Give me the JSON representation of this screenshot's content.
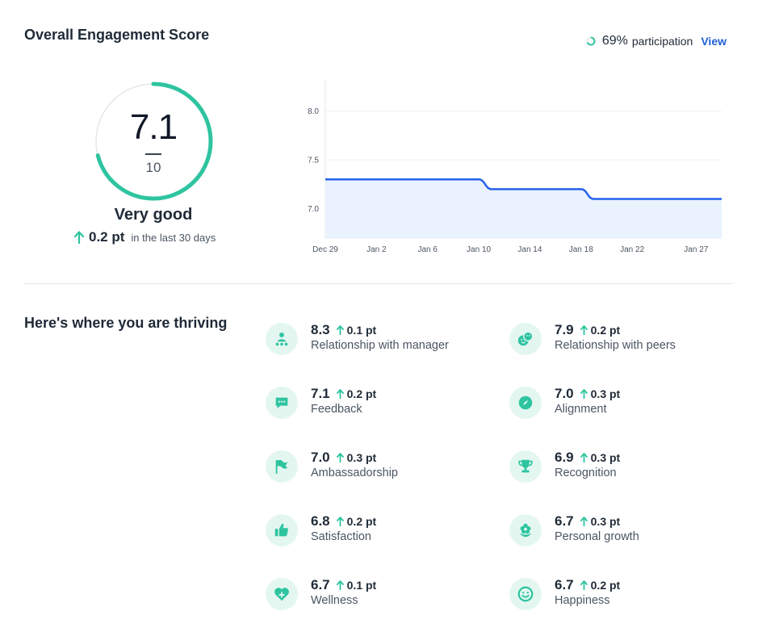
{
  "overall": {
    "title": "Overall Engagement Score",
    "participation_pct": "69%",
    "participation_label": "participation",
    "view_label": "View",
    "score": "7.1",
    "max": "10",
    "score_fraction": 0.71,
    "rating": "Very good",
    "delta": "0.2 pt",
    "delta_period": "in the last 30 days"
  },
  "chart_data": {
    "type": "line",
    "x": [
      "Dec 29",
      "Jan 2",
      "Jan 6",
      "Jan 10",
      "Jan 14",
      "Jan 18",
      "Jan 22",
      "Jan 27"
    ],
    "y_ticks": [
      "8.0",
      "7.5",
      "7.0"
    ],
    "ylim": [
      6.7,
      8.3
    ],
    "grid": true,
    "series": [
      {
        "points": [
          {
            "x": "Dec 29",
            "y": 7.3
          },
          {
            "x": "Jan 10",
            "y": 7.3
          },
          {
            "x": "Jan 11",
            "y": 7.2
          },
          {
            "x": "Jan 18",
            "y": 7.2
          },
          {
            "x": "Jan 19",
            "y": 7.1
          },
          {
            "x": "Jan 29",
            "y": 7.1
          }
        ]
      }
    ],
    "colors": {
      "line": "#2563eb",
      "fill": "#eaf2fe"
    }
  },
  "thriving": {
    "title": "Here's where you are thriving",
    "accent": "#2ec4a0",
    "items": [
      {
        "score": "8.3",
        "change": "0.1 pt",
        "label": "Relationship with manager",
        "icon": "manager-icon"
      },
      {
        "score": "7.9",
        "change": "0.2 pt",
        "label": "Relationship with peers",
        "icon": "peers-icon"
      },
      {
        "score": "7.1",
        "change": "0.2 pt",
        "label": "Feedback",
        "icon": "chat-bubble-icon"
      },
      {
        "score": "7.0",
        "change": "0.3 pt",
        "label": "Alignment",
        "icon": "compass-icon"
      },
      {
        "score": "7.0",
        "change": "0.3 pt",
        "label": "Ambassadorship",
        "icon": "flag-icon"
      },
      {
        "score": "6.9",
        "change": "0.3 pt",
        "label": "Recognition",
        "icon": "trophy-icon"
      },
      {
        "score": "6.8",
        "change": "0.2 pt",
        "label": "Satisfaction",
        "icon": "thumbs-up-icon"
      },
      {
        "score": "6.7",
        "change": "0.3 pt",
        "label": "Personal growth",
        "icon": "flower-icon"
      },
      {
        "score": "6.7",
        "change": "0.1 pt",
        "label": "Wellness",
        "icon": "heart-plus-icon"
      },
      {
        "score": "6.7",
        "change": "0.2 pt",
        "label": "Happiness",
        "icon": "smile-icon"
      }
    ]
  }
}
